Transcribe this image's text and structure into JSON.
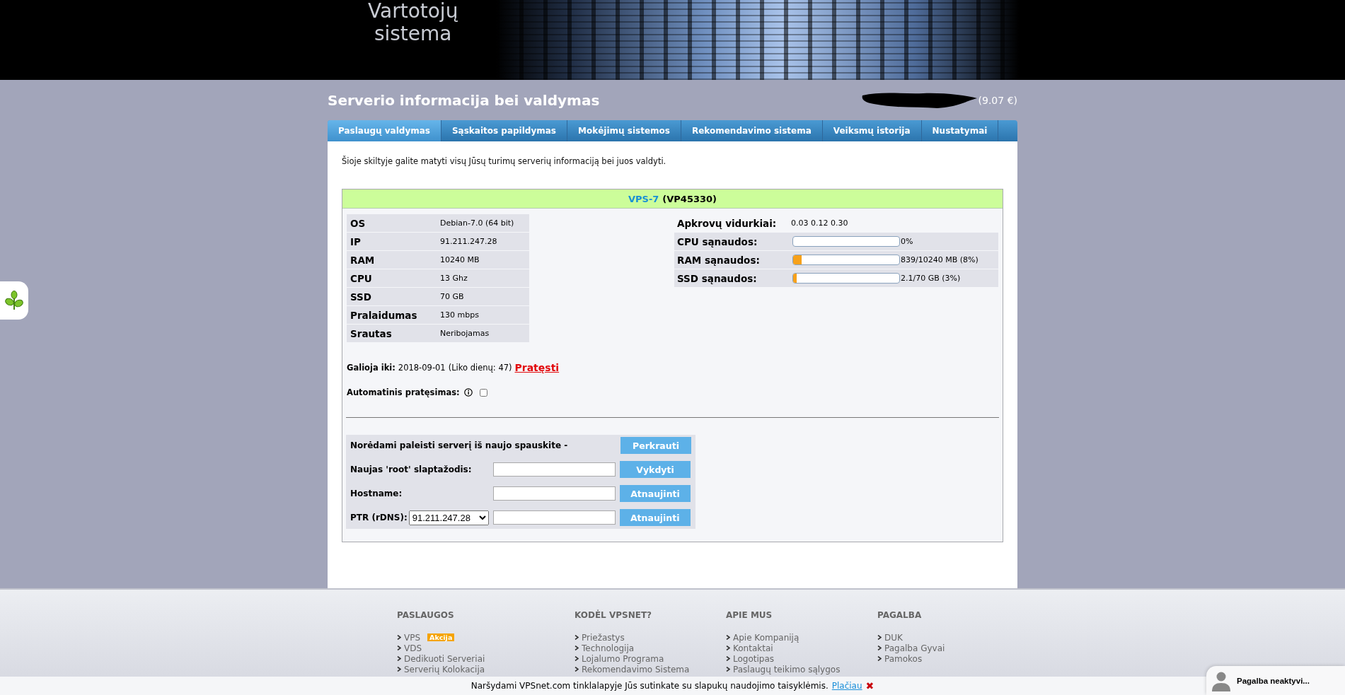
{
  "header": {
    "logo_lines": [
      "Vartotojų",
      "sistema"
    ]
  },
  "page": {
    "title": "Serverio informacija bei valdymas",
    "balance": "(9.07 €)"
  },
  "tabs": [
    {
      "label": "Paslaugų valdymas",
      "selected": true
    },
    {
      "label": "Sąskaitos papildymas",
      "selected": false
    },
    {
      "label": "Mokėjimų sistemos",
      "selected": false
    },
    {
      "label": "Rekomendavimo sistema",
      "selected": false
    },
    {
      "label": "Veiksmų istorija",
      "selected": false
    },
    {
      "label": "Nustatymai",
      "selected": false
    }
  ],
  "intro": "Šioje skiltyje galite matyti visų Jūsų turimų serverių informaciją bei juos valdyti.",
  "server": {
    "name": "VPS-7",
    "code": "(VP45330)",
    "specs": [
      {
        "label": "OS",
        "value": "Debian-7.0 (64 bit)"
      },
      {
        "label": "IP",
        "value": "91.211.247.28"
      },
      {
        "label": "RAM",
        "value": "10240 MB"
      },
      {
        "label": "CPU",
        "value": "13 Ghz"
      },
      {
        "label": "SSD",
        "value": "70 GB"
      },
      {
        "label": "Pralaidumas",
        "value": "130 mbps"
      },
      {
        "label": "Srautas",
        "value": "Neribojamas"
      }
    ],
    "usage": [
      {
        "kind": "text",
        "label": "Apkrovų vidurkiai:",
        "reading": "0.03 0.12 0.30"
      },
      {
        "kind": "meter",
        "label": "CPU sąnaudos:",
        "level": 0,
        "reading": "0%"
      },
      {
        "kind": "meter",
        "label": "RAM sąnaudos:",
        "level": 0.08,
        "reading": "839/10240 MB (8%)"
      },
      {
        "kind": "meter",
        "label": "SSD sąnaudos:",
        "level": 0.03,
        "reading": "2.1/70 GB (3%)"
      }
    ],
    "expiry": {
      "label": "Galioja iki:",
      "date": "2018-09-01",
      "remaining": "(Liko dienų: 47)",
      "renew_link": "Pratęsti"
    },
    "auto_renew": {
      "label": "Automatinis pratęsimas:",
      "checked": false
    },
    "actions": [
      {
        "kind": "button",
        "label": "Norėdami paleisti serverį iš naujo spauskite -",
        "button": "Perkrauti"
      },
      {
        "kind": "input",
        "label": "Naujas 'root' slaptažodis:",
        "button": "Vykdyti"
      },
      {
        "kind": "input",
        "label": "Hostname:",
        "button": "Atnaujinti"
      },
      {
        "kind": "select_input",
        "label": "PTR (rDNS):",
        "select": "91.211.247.28",
        "button": "Atnaujinti"
      }
    ]
  },
  "footer": {
    "columns": [
      {
        "title": "PASLAUGOS",
        "links": [
          {
            "label": "VPS",
            "badge": "Akcija"
          },
          {
            "label": "VDS"
          },
          {
            "label": "Dedikuoti Serveriai"
          },
          {
            "label": "Serverių Kolokacija"
          }
        ]
      },
      {
        "title": "KODĖL VPSNET?",
        "links": [
          {
            "label": "Priežastys"
          },
          {
            "label": "Technologija"
          },
          {
            "label": "Lojalumo Programa"
          },
          {
            "label": "Rekomendavimo Sistema"
          }
        ]
      },
      {
        "title": "APIE MUS",
        "links": [
          {
            "label": "Apie Kompaniją"
          },
          {
            "label": "Kontaktai"
          },
          {
            "label": "Logotipas"
          },
          {
            "label": "Paslaugų teikimo sąlygos"
          }
        ]
      },
      {
        "title": "PAGALBA",
        "links": [
          {
            "label": "DUK"
          },
          {
            "label": "Pagalba Gyvai"
          },
          {
            "label": "Pamokos"
          }
        ]
      }
    ]
  },
  "cookie_notice": {
    "text": "Naršydami VPSnet.com tinklalapyje Jūs sutinkate su slapukų naudojimo taisyklėmis.",
    "link": "Plačiau",
    "close": "✖"
  },
  "chat": {
    "label": "Pagalba neaktyvi..."
  }
}
